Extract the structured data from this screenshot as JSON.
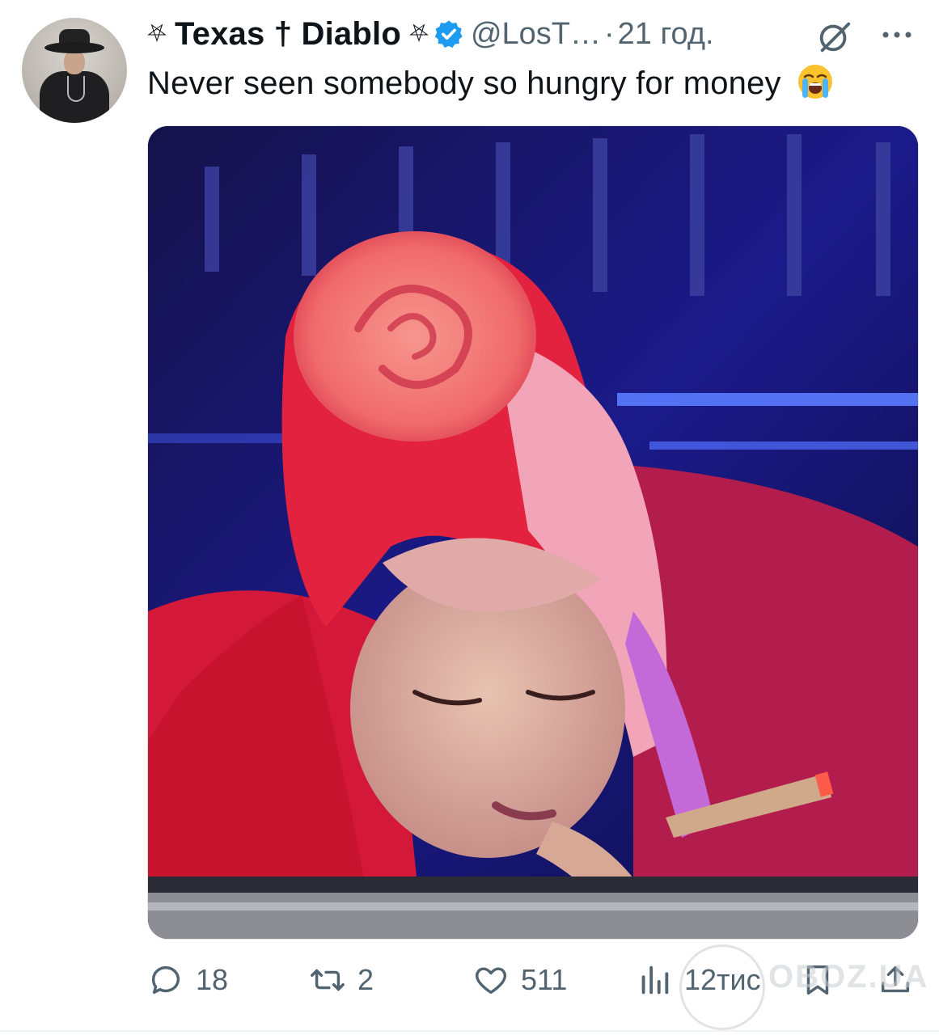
{
  "author": {
    "display_name": "Texas † Diablo",
    "name_prefix_glyph": "⛧",
    "name_suffix_glyph": "⛧",
    "handle": "@LosT…",
    "separator": "·",
    "time": "21 год.",
    "verified": true,
    "verified_color": "#1d9bf0"
  },
  "tweet": {
    "text": "Never seen somebody so hungry for money",
    "emoji": "loudly-crying-face-emoji"
  },
  "media": {
    "type": "photo"
  },
  "actions": {
    "replies": "18",
    "reposts": "2",
    "likes": "511",
    "views": "12тис"
  },
  "watermark": {
    "text": "OBOZ.UA"
  },
  "icons": {
    "reply": "reply-icon",
    "repost": "repost-icon",
    "like": "heart-icon",
    "views": "views-icon",
    "bookmark": "bookmark-icon",
    "share": "share-icon",
    "grok": "grok-icon",
    "more": "more-icon"
  },
  "colors": {
    "text": "#0f1419",
    "secondary": "#536471",
    "accent": "#1d9bf0"
  }
}
